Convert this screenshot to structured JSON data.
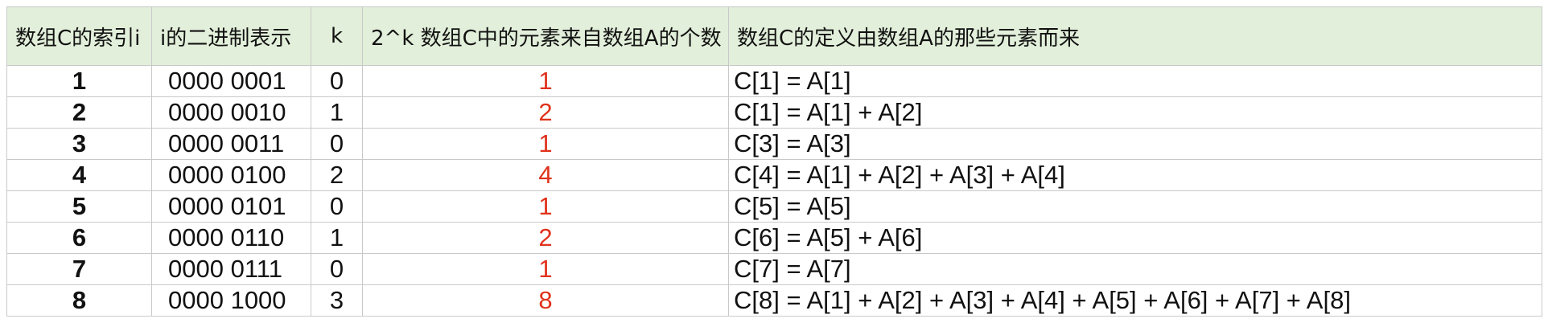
{
  "table": {
    "headers": [
      "数组C的索引i",
      "i的二进制表示",
      "k",
      "2^k 数组C中的元素来自数组A的个数",
      "数组C的定义由数组A的那些元素而来"
    ],
    "rows": [
      {
        "i": "1",
        "binary": "0000 0001",
        "k": "0",
        "count": "1",
        "definition": "C[1] = A[1]"
      },
      {
        "i": "2",
        "binary": "0000 0010",
        "k": "1",
        "count": "2",
        "definition": "C[1] = A[1] + A[2]"
      },
      {
        "i": "3",
        "binary": "0000 0011",
        "k": "0",
        "count": "1",
        "definition": "C[3] = A[3]"
      },
      {
        "i": "4",
        "binary": "0000 0100",
        "k": "2",
        "count": "4",
        "definition": "C[4] = A[1] + A[2] + A[3] + A[4]"
      },
      {
        "i": "5",
        "binary": "0000 0101",
        "k": "0",
        "count": "1",
        "definition": "C[5] = A[5]"
      },
      {
        "i": "6",
        "binary": "0000 0110",
        "k": "1",
        "count": "2",
        "definition": "C[6] = A[5] + A[6]"
      },
      {
        "i": "7",
        "binary": "0000 0111",
        "k": "0",
        "count": "1",
        "definition": "C[7] = A[7]"
      },
      {
        "i": "8",
        "binary": "0000 1000",
        "k": "3",
        "count": "8",
        "definition": "C[8] = A[1] + A[2] + A[3] + A[4] + A[5] + A[6] + A[7] + A[8]"
      }
    ]
  },
  "colors": {
    "header_background": "#e2efda",
    "count_text": "#e0321c",
    "grid_line": "#c9c9c9"
  }
}
